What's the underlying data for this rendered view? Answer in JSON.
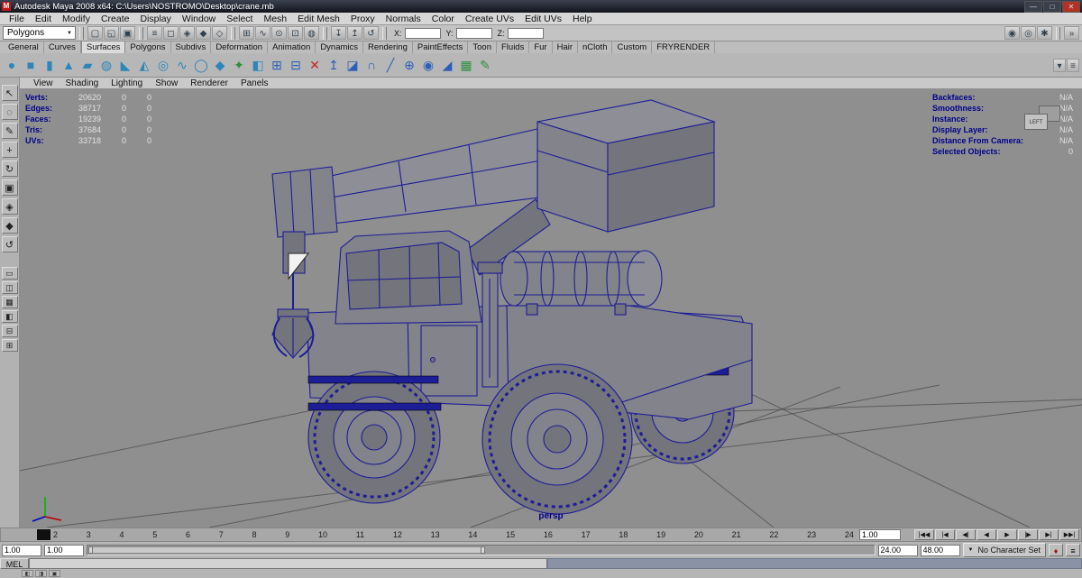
{
  "colors": {
    "viewport-bg": "#8f8f8f",
    "wireframe": "#1d1d96",
    "model-fill": "#83838b",
    "model-dark": "#74747c",
    "model-light": "#8e8e96",
    "grid-line": "#4b4b4b",
    "hud-label": "#00008c",
    "hud-value": "#e2e2e2",
    "accent-red": "#c01818"
  },
  "window": {
    "title": "Autodesk Maya 2008 x64: C:\\Users\\NOSTROMO\\Desktop\\crane.mb",
    "app_icon": "M",
    "controls": {
      "minimize": "—",
      "maximize": "□",
      "close": "✕"
    }
  },
  "menu_bar": {
    "items": [
      "File",
      "Edit",
      "Modify",
      "Create",
      "Display",
      "Window",
      "Select",
      "Mesh",
      "Edit Mesh",
      "Proxy",
      "Normals",
      "Color",
      "Create UVs",
      "Edit UVs",
      "Help"
    ]
  },
  "icons": {
    "chevron_down": "▼"
  },
  "status_line": {
    "mode_selector": "Polygons",
    "file_icons": [
      {
        "name": "new-scene-icon",
        "glyph": "▢"
      },
      {
        "name": "open-scene-icon",
        "glyph": "◱"
      },
      {
        "name": "save-scene-icon",
        "glyph": "▣"
      }
    ],
    "selection_icons": [
      {
        "name": "select-hierarchy-icon",
        "glyph": "≡"
      },
      {
        "name": "select-object-icon",
        "glyph": "◻"
      },
      {
        "name": "select-component-icon",
        "glyph": "◈"
      },
      {
        "name": "lock-selection-icon",
        "glyph": "◆"
      },
      {
        "name": "highlight-selection-icon",
        "glyph": "◇"
      }
    ],
    "snap_icons": [
      {
        "name": "snap-to-grid-icon",
        "glyph": "⊞"
      },
      {
        "name": "snap-to-curve-icon",
        "glyph": "∿"
      },
      {
        "name": "snap-to-point-icon",
        "glyph": "⊙"
      },
      {
        "name": "snap-to-plane-icon",
        "glyph": "⊡"
      },
      {
        "name": "make-live-icon",
        "glyph": "◍"
      }
    ],
    "history_icons": [
      {
        "name": "input-connections-icon",
        "glyph": "↧"
      },
      {
        "name": "output-connections-icon",
        "glyph": "↥"
      },
      {
        "name": "construction-history-icon",
        "glyph": "↺"
      }
    ],
    "coords": {
      "x_label": "X:",
      "y_label": "Y:",
      "z_label": "Z:",
      "x_value": "",
      "y_value": "",
      "z_value": ""
    },
    "render_icons": [
      {
        "name": "render-current-frame-icon",
        "glyph": "◉"
      },
      {
        "name": "ipr-render-icon",
        "glyph": "◎"
      },
      {
        "name": "render-settings-icon",
        "glyph": "✱"
      }
    ],
    "panel_toggle_icons": [
      {
        "name": "toggle-sidebar-icon",
        "glyph": "»"
      }
    ]
  },
  "shelf": {
    "tabs": [
      {
        "label": "General"
      },
      {
        "label": "Curves"
      },
      {
        "label": "Surfaces",
        "active": true
      },
      {
        "label": "Polygons"
      },
      {
        "label": "Subdivs"
      },
      {
        "label": "Deformation"
      },
      {
        "label": "Animation"
      },
      {
        "label": "Dynamics"
      },
      {
        "label": "Rendering"
      },
      {
        "label": "PaintEffects"
      },
      {
        "label": "Toon"
      },
      {
        "label": "Fluids"
      },
      {
        "label": "Fur"
      },
      {
        "label": "Hair"
      },
      {
        "label": "nCloth"
      },
      {
        "label": "Custom"
      },
      {
        "label": "FRYRENDER"
      }
    ],
    "icons": [
      {
        "name": "polygon-sphere-icon",
        "glyph": "●",
        "color": "#2e86b8"
      },
      {
        "name": "polygon-cube-icon",
        "glyph": "■",
        "color": "#2e86b8"
      },
      {
        "name": "polygon-cylinder-icon",
        "glyph": "▮",
        "color": "#2e86b8"
      },
      {
        "name": "polygon-cone-icon",
        "glyph": "▲",
        "color": "#2e86b8"
      },
      {
        "name": "polygon-plane-icon",
        "glyph": "▰",
        "color": "#2e86b8"
      },
      {
        "name": "polygon-torus-icon",
        "glyph": "◍",
        "color": "#2e86b8"
      },
      {
        "name": "polygon-prism-icon",
        "glyph": "◣",
        "color": "#2e86b8"
      },
      {
        "name": "polygon-pyramid-icon",
        "glyph": "◭",
        "color": "#2e86b8"
      },
      {
        "name": "polygon-pipe-icon",
        "glyph": "◎",
        "color": "#2e86b8"
      },
      {
        "name": "polygon-helix-icon",
        "glyph": "∿",
        "color": "#2e86b8"
      },
      {
        "name": "polygon-soccer-ball-icon",
        "glyph": "◯",
        "color": "#2e86b8"
      },
      {
        "name": "polygon-platonic-solid-icon",
        "glyph": "◆",
        "color": "#2e86b8"
      },
      {
        "name": "sculpt-geometry-icon",
        "glyph": "✦",
        "color": "#2f8f3f"
      },
      {
        "name": "mirror-geometry-icon",
        "glyph": "◧",
        "color": "#2e86b8"
      },
      {
        "name": "combine-icon",
        "glyph": "⊞",
        "color": "#2e5fb8"
      },
      {
        "name": "separate-icon",
        "glyph": "⊟",
        "color": "#2e5fb8"
      },
      {
        "name": "delete-faces-icon",
        "glyph": "✕",
        "color": "#c62222"
      },
      {
        "name": "extrude-icon",
        "glyph": "↥",
        "color": "#2e5fb8"
      },
      {
        "name": "bevel-icon",
        "glyph": "◪",
        "color": "#2e5fb8"
      },
      {
        "name": "bridge-icon",
        "glyph": "∩",
        "color": "#2e5fb8"
      },
      {
        "name": "split-polygon-icon",
        "glyph": "╱",
        "color": "#2e5fb8"
      },
      {
        "name": "merge-vertices-icon",
        "glyph": "⊕",
        "color": "#2e5fb8"
      },
      {
        "name": "smooth-icon",
        "glyph": "◉",
        "color": "#2e5fb8"
      },
      {
        "name": "wedge-icon",
        "glyph": "◢",
        "color": "#2e5fb8"
      },
      {
        "name": "uv-texture-editor-icon",
        "glyph": "▦",
        "color": "#2f8f3f"
      },
      {
        "name": "paint-effects-icon",
        "glyph": "✎",
        "color": "#2f8f3f"
      }
    ],
    "menu_icons": [
      {
        "name": "shelf-overflow-icon",
        "glyph": "▾"
      },
      {
        "name": "shelf-editor-icon",
        "glyph": "≡"
      }
    ]
  },
  "toolbox": {
    "tools": [
      {
        "name": "select-tool-icon",
        "glyph": "↖"
      },
      {
        "name": "lasso-select-tool-icon",
        "glyph": "◌"
      },
      {
        "name": "paint-select-tool-icon",
        "glyph": "✎"
      },
      {
        "name": "move-tool-icon",
        "glyph": "+"
      },
      {
        "name": "rotate-tool-icon",
        "glyph": "↻"
      },
      {
        "name": "scale-tool-icon",
        "glyph": "▣"
      },
      {
        "name": "universal-manipulator-icon",
        "glyph": "◈"
      },
      {
        "name": "show-manipulator-icon",
        "glyph": "◆"
      },
      {
        "name": "last-tool-icon",
        "glyph": "↺"
      }
    ],
    "layouts": [
      {
        "name": "single-pane-layout-button",
        "glyph": "▭"
      },
      {
        "name": "two-pane-layout-button",
        "glyph": "◫"
      },
      {
        "name": "four-pane-layout-button",
        "glyph": "▦"
      },
      {
        "name": "persp-outliner-layout-button",
        "glyph": "◧"
      },
      {
        "name": "persp-graph-layout-button",
        "glyph": "⊟"
      },
      {
        "name": "hypershade-layout-button",
        "glyph": "⊞"
      }
    ]
  },
  "panel_menu": {
    "items": [
      "View",
      "Shading",
      "Lighting",
      "Show",
      "Renderer",
      "Panels"
    ]
  },
  "hud_left": {
    "rows": [
      {
        "label": "Verts:",
        "value": "20620",
        "a": "0",
        "b": "0"
      },
      {
        "label": "Edges:",
        "value": "38717",
        "a": "0",
        "b": "0"
      },
      {
        "label": "Faces:",
        "value": "19239",
        "a": "0",
        "b": "0"
      },
      {
        "label": "Tris:",
        "value": "37684",
        "a": "0",
        "b": "0"
      },
      {
        "label": "UVs:",
        "value": "33718",
        "a": "0",
        "b": "0"
      }
    ]
  },
  "hud_right": {
    "rows": [
      {
        "label": "Backfaces:",
        "value": "N/A"
      },
      {
        "label": "Smoothness:",
        "value": "N/A"
      },
      {
        "label": "Instance:",
        "value": "N/A"
      },
      {
        "label": "Display Layer:",
        "value": "N/A"
      },
      {
        "label": "Distance From Camera:",
        "value": "N/A"
      },
      {
        "label": "Selected Objects:",
        "value": "0"
      }
    ]
  },
  "view_cube": {
    "label": "LEFT"
  },
  "viewport": {
    "camera_label": "persp"
  },
  "time_slider": {
    "frames": [
      "2",
      "3",
      "4",
      "5",
      "6",
      "7",
      "8",
      "9",
      "10",
      "11",
      "12",
      "13",
      "14",
      "15",
      "16",
      "17",
      "18",
      "19",
      "20",
      "21",
      "22",
      "23",
      "24"
    ],
    "current_time": "1.00",
    "transport": [
      {
        "name": "go-to-start-button",
        "glyph": "|◀◀"
      },
      {
        "name": "step-back-frame-button",
        "glyph": "|◀"
      },
      {
        "name": "step-back-key-button",
        "glyph": "◀|"
      },
      {
        "name": "play-backwards-button",
        "glyph": "◀"
      },
      {
        "name": "play-forwards-button",
        "glyph": "▶"
      },
      {
        "name": "step-forward-key-button",
        "glyph": "|▶"
      },
      {
        "name": "step-forward-frame-button",
        "glyph": "▶|"
      },
      {
        "name": "go-to-end-button",
        "glyph": "▶▶|"
      }
    ]
  },
  "range_slider": {
    "animation_start": "1.00",
    "playback_start": "1.00",
    "playback_end": "24.00",
    "animation_end": "48.00",
    "character_set": "No Character Set",
    "auto_key_glyph": "♦",
    "anim_prefs_glyph": "≡"
  },
  "command_line": {
    "label": "MEL",
    "value": ""
  },
  "help_line": {
    "buttons": [
      {
        "name": "quick-layout-button-1",
        "glyph": "◧"
      },
      {
        "name": "quick-layout-button-2",
        "glyph": "◨"
      },
      {
        "name": "quick-layout-button-3",
        "glyph": "▣"
      }
    ]
  }
}
